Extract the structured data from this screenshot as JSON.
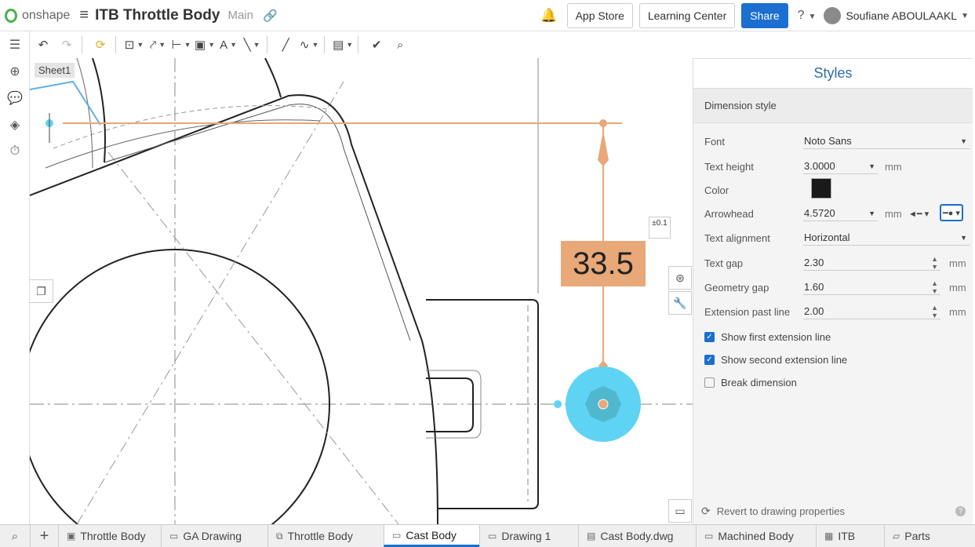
{
  "app": {
    "brand": "onshape",
    "doc_title": "ITB Throttle Body",
    "branch": "Main"
  },
  "header": {
    "app_store": "App Store",
    "learning_center": "Learning Center",
    "share": "Share",
    "user": "Soufiane ABOULAAKL"
  },
  "sheet": {
    "label": "Sheet1"
  },
  "dimension": {
    "value": "33.5",
    "tolerance": "±0.1"
  },
  "panel": {
    "title": "Styles",
    "section": "Dimension style",
    "font": {
      "label": "Font",
      "value": "Noto Sans"
    },
    "text_height": {
      "label": "Text height",
      "value": "3.0000",
      "unit": "mm"
    },
    "color": {
      "label": "Color",
      "value": "#1a1a1a"
    },
    "arrowhead": {
      "label": "Arrowhead",
      "value": "4.5720",
      "unit": "mm"
    },
    "text_alignment": {
      "label": "Text alignment",
      "value": "Horizontal"
    },
    "text_gap": {
      "label": "Text gap",
      "value": "2.30",
      "unit": "mm"
    },
    "geometry_gap": {
      "label": "Geometry gap",
      "value": "1.60",
      "unit": "mm"
    },
    "extension_past_line": {
      "label": "Extension past line",
      "value": "2.00",
      "unit": "mm"
    },
    "checks": [
      {
        "label": "Show first extension line",
        "checked": true
      },
      {
        "label": "Show second extension line",
        "checked": true
      },
      {
        "label": "Break dimension",
        "checked": false
      }
    ],
    "revert": "Revert to drawing properties"
  },
  "tabs": [
    {
      "label": "Throttle Body",
      "icon": "part-studio-icon",
      "active": false
    },
    {
      "label": "GA Drawing",
      "icon": "drawing-icon",
      "active": false
    },
    {
      "label": "Throttle Body",
      "icon": "assembly-icon",
      "active": false
    },
    {
      "label": "Cast Body",
      "icon": "drawing-icon",
      "active": true
    },
    {
      "label": "Drawing 1",
      "icon": "drawing-icon",
      "active": false
    },
    {
      "label": "Cast Body.dwg",
      "icon": "dwg-file-icon",
      "active": false
    },
    {
      "label": "Machined Body",
      "icon": "drawing-icon",
      "active": false
    },
    {
      "label": "ITB",
      "icon": "video-file-icon",
      "active": false
    },
    {
      "label": "Parts",
      "icon": "folder-icon",
      "active": false
    }
  ],
  "colors": {
    "accent": "#1a6fd0",
    "dimension": "#e8a878",
    "highlight": "#5fd3f3",
    "title": "#2d6ea8"
  }
}
